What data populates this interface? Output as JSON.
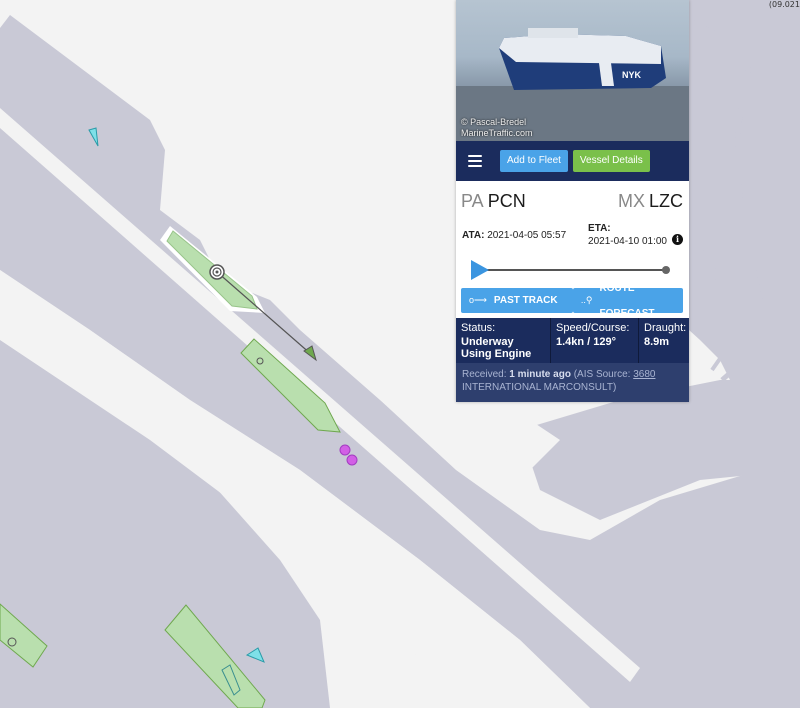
{
  "map": {
    "corner_text": "(09.021",
    "colors": {
      "water": "#c9c9d6",
      "land": "#f3f3f3",
      "vessel": "#b9dfae"
    }
  },
  "panel": {
    "photo_credit_line1": "© Pascal-Bredel",
    "photo_credit_line2": "MarineTraffic.com",
    "toolbar": {
      "add_to_fleet": "Add to Fleet",
      "vessel_details": "Vessel Details"
    },
    "departure": {
      "country": "PA",
      "code": "PCN"
    },
    "arrival": {
      "country": "MX",
      "code": "LZC"
    },
    "ata_label": "ATA:",
    "ata_value": "2021-04-05 05:57",
    "eta_label": "ETA:",
    "eta_value": "2021-04-10 01:00",
    "past_track": "PAST TRACK",
    "route_forecast": "ROUTE FORECAST",
    "status_label": "Status:",
    "status_value": "Underway Using Engine",
    "speed_label": "Speed/Course:",
    "speed_value": "1.4kn / 129°",
    "draught_label": "Draught:",
    "draught_value": "8.9m",
    "received_label": "Received:",
    "received_value": "1 minute ago",
    "ais_prefix": "(AIS Source:",
    "ais_id": "3680",
    "ais_name": "INTERNATIONAL MARCONSULT)"
  }
}
